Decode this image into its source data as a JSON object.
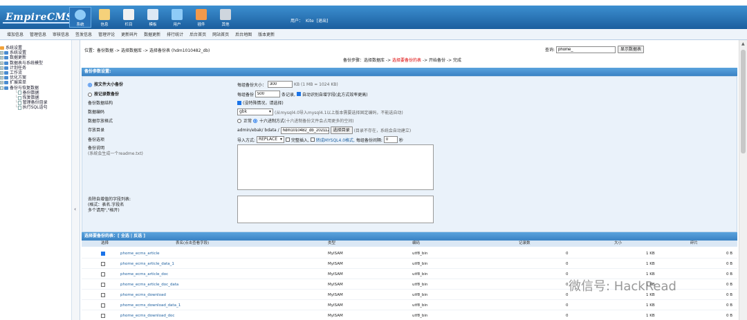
{
  "header": {
    "logo": "EmpireCMS",
    "nav": [
      {
        "label": "系统",
        "icon": "globe-icon",
        "color": "#8ecbf7"
      },
      {
        "label": "信息",
        "icon": "edit-icon",
        "color": "#f5d17a"
      },
      {
        "label": "栏目",
        "icon": "folder-icon",
        "color": "#f1f1f1"
      },
      {
        "label": "模板",
        "icon": "template-icon",
        "color": "#dce8f5"
      },
      {
        "label": "用户",
        "icon": "user-icon",
        "color": "#8ecbf7"
      },
      {
        "label": "插件",
        "icon": "plugin-icon",
        "color": "#f2994a"
      },
      {
        "label": "其他",
        "icon": "gear-icon",
        "color": "#cfd6de"
      }
    ],
    "user_label": "用户：",
    "user_name": "Kite",
    "logout": "[退出]"
  },
  "submenu": [
    "增加信息",
    "管理信息",
    "审核信息",
    "签发信息",
    "管理评论",
    "更新碎片",
    "数据更新",
    "排行统计",
    "后台首页",
    "网站首页",
    "后台地图",
    "版本更新"
  ],
  "sidebar": {
    "items": [
      "系统设置",
      "系统设置",
      "数据更新",
      "数据表与系统模型",
      "计划任务",
      "工作流",
      "优化方案",
      "扩展菜单",
      "备份与恢复数据"
    ],
    "children": [
      "备份数据",
      "恢复数据",
      "管理备份目录",
      "执行SQL语句"
    ]
  },
  "main": {
    "crumb": "位置：备份数据 -> 选择数据库 -> 选择备份表 (hdm1010482_db)",
    "search_label": "查询:",
    "search_value": "phome_",
    "search_button": "显示数据表",
    "steps_prefix": "备份步骤：选择数据库 -> ",
    "steps_current": "选择要备份的表",
    "steps_suffix": " -> 开始备份 -> 完成",
    "section_title": "备份参数设置:",
    "opt_size": "按文件大小备份",
    "opt_size_label": "每组备份大小：",
    "opt_size_value": "300",
    "opt_size_unit": "KB (1 MB = 1024 KB)",
    "opt_count": "按记录数备份",
    "opt_count_label": "每组备份",
    "opt_count_value": "500",
    "opt_count_unit": "条记录,",
    "opt_count_auto": "自动识别自增字段(此方式效率更高)",
    "struct_label": "备份数据结构",
    "struct_value": "(没特殊情况，请选择)",
    "enc_label": "数据编码",
    "enc_value": "gbk",
    "enc_note": "(从mysql4.0导入mysql4.1以上版本需要选择固定编码，不能选自动)",
    "store_label": "数据存放格式",
    "store_normal": "正常",
    "store_hex": "十六进制方式",
    "store_hex_note": "(十六进制备份文件会占用更多的空间)",
    "dir_label": "存放目录",
    "dir_prefix": "admin/ebak/ bdata /",
    "dir_value": "hdm1010482_db_2021122",
    "dir_button": "选择目录",
    "dir_note": "(目录不存在，系统会自动建立)",
    "opt_label": "备份选项",
    "import_label": "导入方式:",
    "import_value": "REPLACE",
    "ins_label": "完整插入,",
    "compat_label": "转成MYSQL4.0格式,",
    "interval_label": "每组备份间隔:",
    "interval_value": "0",
    "interval_unit": "秒",
    "readme_label": "备份说明",
    "readme_note": "(系统会生成一个readme.txt)",
    "exclude_label": "去除自增值的字段列表:",
    "exclude_note1": "(格式：表名.字段名",
    "exclude_note2": "多个请用\",\"格开)",
    "table_title": "选择要备份的表：[ 全选 | 反选 ]",
    "columns": [
      "选择",
      "表名(点击查看字段)",
      "类型",
      "编码",
      "记录数",
      "大小",
      "碎片"
    ],
    "rows": [
      {
        "checked": true,
        "name": "phome_ecms_article",
        "type": "MyISAM",
        "enc": "utf8_bin",
        "records": "0",
        "size": "1 KB",
        "frag": "0 B"
      },
      {
        "checked": false,
        "name": "phome_ecms_article_data_1",
        "type": "MyISAM",
        "enc": "utf8_bin",
        "records": "0",
        "size": "1 KB",
        "frag": "0 B"
      },
      {
        "checked": false,
        "name": "phome_ecms_article_doc",
        "type": "MyISAM",
        "enc": "utf8_bin",
        "records": "0",
        "size": "1 KB",
        "frag": "0 B"
      },
      {
        "checked": false,
        "name": "phome_ecms_article_doc_data",
        "type": "MyISAM",
        "enc": "utf8_bin",
        "records": "0",
        "size": "1 KB",
        "frag": "0 B"
      },
      {
        "checked": false,
        "name": "phome_ecms_download",
        "type": "MyISAM",
        "enc": "utf8_bin",
        "records": "0",
        "size": "1 KB",
        "frag": "0 B"
      },
      {
        "checked": false,
        "name": "phome_ecms_download_data_1",
        "type": "MyISAM",
        "enc": "utf8_bin",
        "records": "0",
        "size": "1 KB",
        "frag": "0 B"
      },
      {
        "checked": false,
        "name": "phome_ecms_download_doc",
        "type": "MyISAM",
        "enc": "utf8_bin",
        "records": "0",
        "size": "1 KB",
        "frag": "0 B"
      }
    ]
  },
  "watermark": "微信号: HackRead"
}
